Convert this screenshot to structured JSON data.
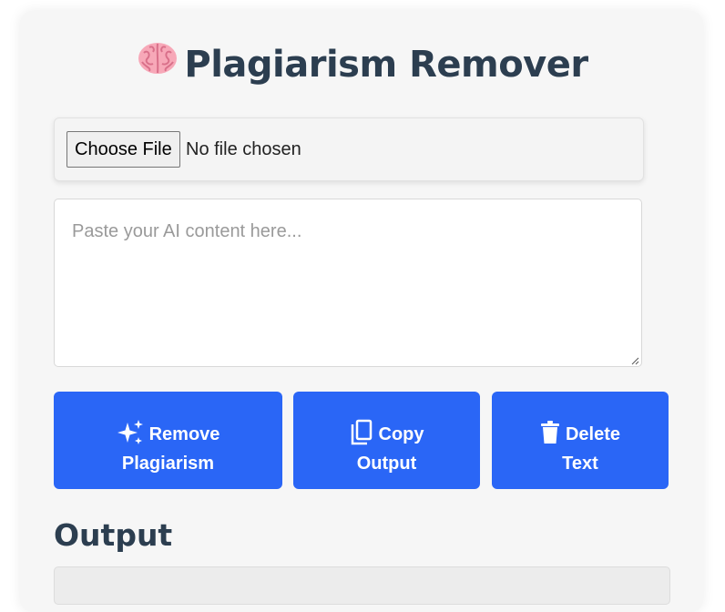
{
  "app": {
    "title": "Plagiarism Remover",
    "title_icon": "brain-icon"
  },
  "file_input": {
    "button_label": "Choose File",
    "status": "No file chosen"
  },
  "content_input": {
    "placeholder": "Paste your AI content here...",
    "value": ""
  },
  "actions": {
    "remove": {
      "line1": "Remove",
      "line2": "Plagiarism",
      "icon": "sparkles-icon"
    },
    "copy": {
      "line1": "Copy",
      "line2": "Output",
      "icon": "copy-icon"
    },
    "delete": {
      "line1": "Delete",
      "line2": "Text",
      "icon": "trash-icon"
    }
  },
  "output": {
    "heading": "Output",
    "value": ""
  },
  "colors": {
    "accent": "#2a66f6",
    "heading": "#2c3e50",
    "card": "#f6f6f6"
  }
}
